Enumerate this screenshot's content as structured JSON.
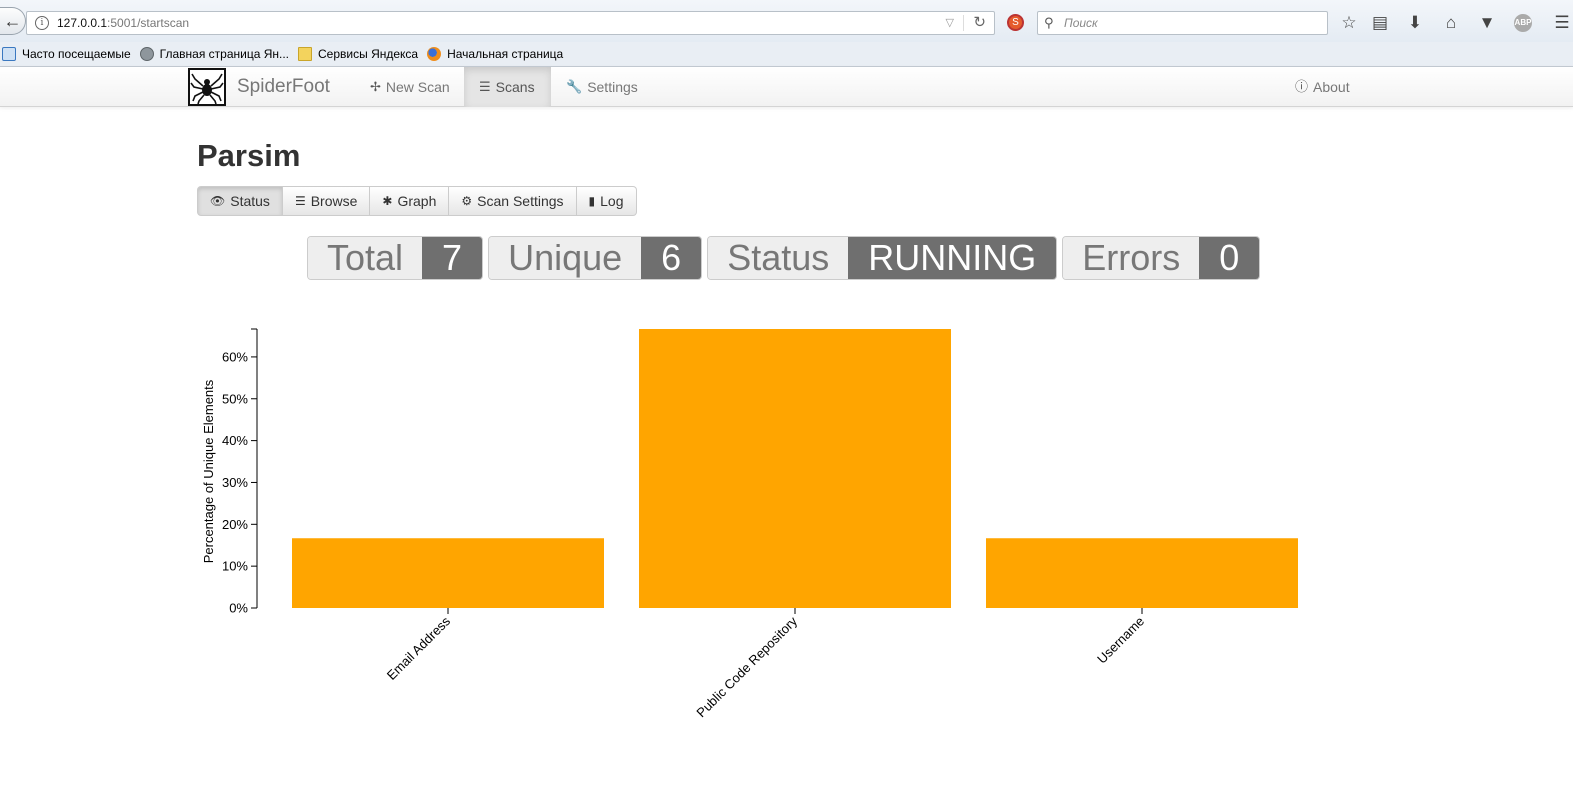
{
  "browser": {
    "url_host": "127.0.0.1",
    "url_rest": ":5001/startscan",
    "search_placeholder": "Поиск",
    "bookmarks": [
      {
        "label": "Часто посещаемые",
        "icon": "apps-icon"
      },
      {
        "label": "Главная страница Ян...",
        "icon": "globe-icon"
      },
      {
        "label": "Сервисы Яндекса",
        "icon": "folder-icon"
      },
      {
        "label": "Начальная страница",
        "icon": "firefox-icon"
      }
    ]
  },
  "nav": {
    "brand": "SpiderFoot",
    "new_scan": "New Scan",
    "scans": "Scans",
    "settings": "Settings",
    "about": "About"
  },
  "scan": {
    "title": "Parsim",
    "tabs": {
      "status": "Status",
      "browse": "Browse",
      "graph": "Graph",
      "scan_settings": "Scan Settings",
      "log": "Log"
    },
    "stats": {
      "total_label": "Total",
      "total_value": "7",
      "unique_label": "Unique",
      "unique_value": "6",
      "status_label": "Status",
      "status_value": "RUNNING",
      "errors_label": "Errors",
      "errors_value": "0"
    }
  },
  "chart_data": {
    "type": "bar",
    "categories": [
      "Email Address",
      "Public Code Repository",
      "Username"
    ],
    "values": [
      16.67,
      66.67,
      16.67
    ],
    "ylabel": "Percentage of Unique Elements",
    "xlabel": "",
    "ylim": [
      0,
      66.67
    ],
    "yticks": [
      "0%",
      "10%",
      "20%",
      "30%",
      "40%",
      "50%",
      "60%"
    ],
    "bar_color": "#ffa500",
    "grid": false
  }
}
